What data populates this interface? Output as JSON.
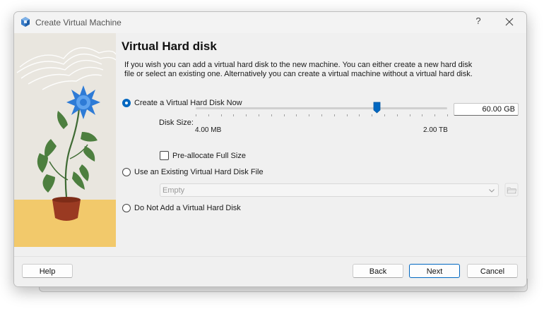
{
  "window": {
    "title": "Create Virtual Machine",
    "help_glyph": "?",
    "app_icon": "virtualbox-cube-icon"
  },
  "page": {
    "title": "Virtual Hard disk",
    "intro_line1": "If you wish you can add a virtual hard disk to the new machine. You can either create a new hard disk",
    "intro_line2": "file or select an existing one. Alternatively you can create a virtual machine without a virtual hard disk."
  },
  "options": {
    "create_now": {
      "label": "Create a Virtual Hard Disk Now",
      "checked": true
    },
    "use_existing": {
      "label": "Use an Existing Virtual Hard Disk File",
      "checked": false
    },
    "do_not_add": {
      "label": "Do Not Add a Virtual Hard Disk",
      "checked": false
    }
  },
  "disk": {
    "size_label": "Disk Size:",
    "size_value": "60.00 GB",
    "slider_min_label": "4.00 MB",
    "slider_max_label": "2.00 TB",
    "slider_fraction": 0.72,
    "preallocate_label": "Pre-allocate Full Size",
    "preallocate_checked": false
  },
  "existing": {
    "combo_value": "Empty",
    "combo_enabled": false,
    "browse_icon": "folder-open-icon"
  },
  "buttons": {
    "help": "Help",
    "back": "Back",
    "next": "Next",
    "cancel": "Cancel"
  },
  "colors": {
    "accent": "#0067c0",
    "flower": "#2e7bd6",
    "pot": "#9a3a22",
    "ground": "#f2c96b",
    "leaf": "#4d7f3f"
  }
}
